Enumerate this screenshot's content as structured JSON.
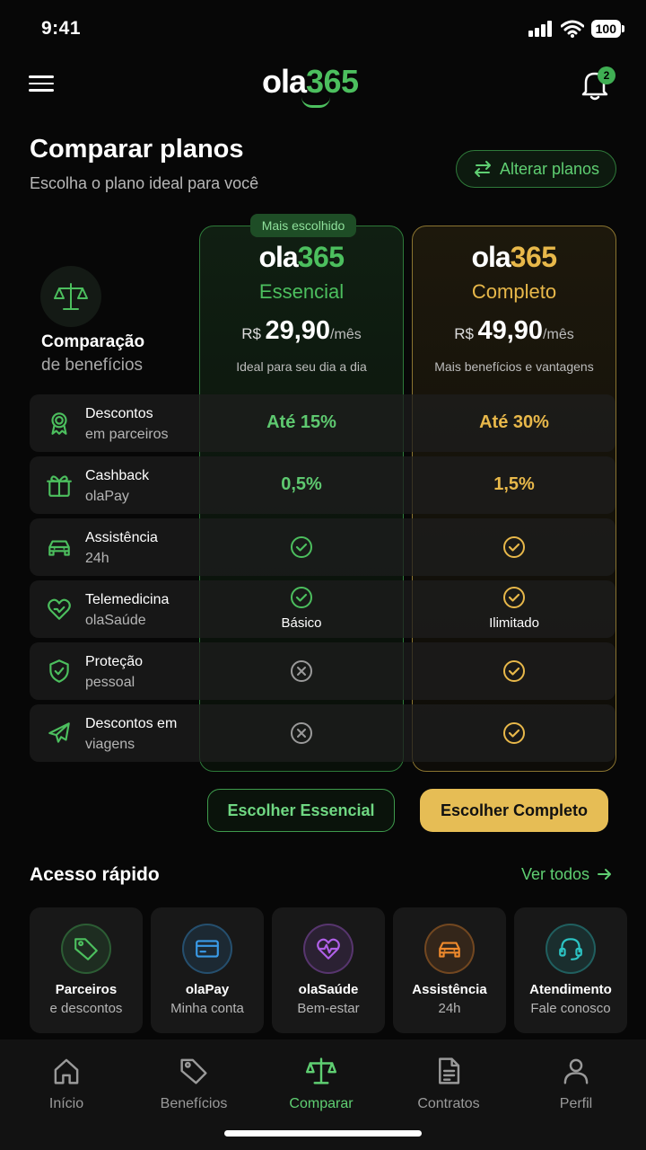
{
  "status_bar": {
    "time": "9:41",
    "battery": "100"
  },
  "header": {
    "logo_text": "ola",
    "logo_number": "365",
    "notification_count": "2"
  },
  "page": {
    "title": "Comparar planos",
    "subtitle": "Escolha o plano ideal para você",
    "alter_button": "Alterar planos"
  },
  "comparison": {
    "title": "Comparação",
    "subtitle": "de benefícios",
    "badge": "Mais escolhido",
    "plans": [
      {
        "logo_text": "ola",
        "logo_number": "365",
        "name": "Essencial",
        "currency": "R$",
        "price": "29,90",
        "period": "/mês",
        "description": "Ideal para seu dia a dia",
        "button": "Escolher Essencial",
        "color": "#4cbf5e"
      },
      {
        "logo_text": "ola",
        "logo_number": "365",
        "name": "Completo",
        "currency": "R$",
        "price": "49,90",
        "period": "/mês",
        "description": "Mais benefícios e vantagens",
        "button": "Escolher Completo",
        "color": "#e8b84a"
      }
    ],
    "rows": [
      {
        "icon": "award-icon",
        "label1": "Descontos",
        "label2": "em parceiros",
        "essencial": "Até 15%",
        "completo": "Até 30%"
      },
      {
        "icon": "gift-icon",
        "label1": "Cashback",
        "label2": "olaPay",
        "essencial": "0,5%",
        "completo": "1,5%"
      },
      {
        "icon": "car-icon",
        "label1": "Assistência",
        "label2": "24h",
        "essencial": "check",
        "completo": "check"
      },
      {
        "icon": "heart-hand-icon",
        "label1": "Telemedicina",
        "label2": "olaSaúde",
        "essencial": "check",
        "essencial_note": "Básico",
        "completo": "check",
        "completo_note": "Ilimitado"
      },
      {
        "icon": "shield-check-icon",
        "label1": "Proteção",
        "label2": "pessoal",
        "essencial": "cross",
        "completo": "check"
      },
      {
        "icon": "plane-icon",
        "label1": "Descontos em",
        "label2": "viagens",
        "essencial": "cross",
        "completo": "check"
      }
    ]
  },
  "quick_access": {
    "title": "Acesso rápido",
    "see_all": "Ver todos",
    "items": [
      {
        "icon": "tag-icon",
        "title": "Parceiros",
        "subtitle": "e descontos",
        "color": "#4cbf5e"
      },
      {
        "icon": "card-icon",
        "title": "olaPay",
        "subtitle": "Minha conta",
        "color": "#3a9be8"
      },
      {
        "icon": "heart-pulse-icon",
        "title": "olaSaúde",
        "subtitle": "Bem-estar",
        "color": "#b060e8"
      },
      {
        "icon": "car-icon",
        "title": "Assistência",
        "subtitle": "24h",
        "color": "#f08a2c"
      },
      {
        "icon": "headset-icon",
        "title": "Atendimento",
        "subtitle": "Fale conosco",
        "color": "#2cc4c4"
      }
    ]
  },
  "bottom_nav": [
    {
      "icon": "home-icon",
      "label": "Início",
      "active": false
    },
    {
      "icon": "tag-icon",
      "label": "Benefícios",
      "active": false
    },
    {
      "icon": "scale-icon",
      "label": "Comparar",
      "active": true
    },
    {
      "icon": "document-icon",
      "label": "Contratos",
      "active": false
    },
    {
      "icon": "user-icon",
      "label": "Perfil",
      "active": false
    }
  ]
}
